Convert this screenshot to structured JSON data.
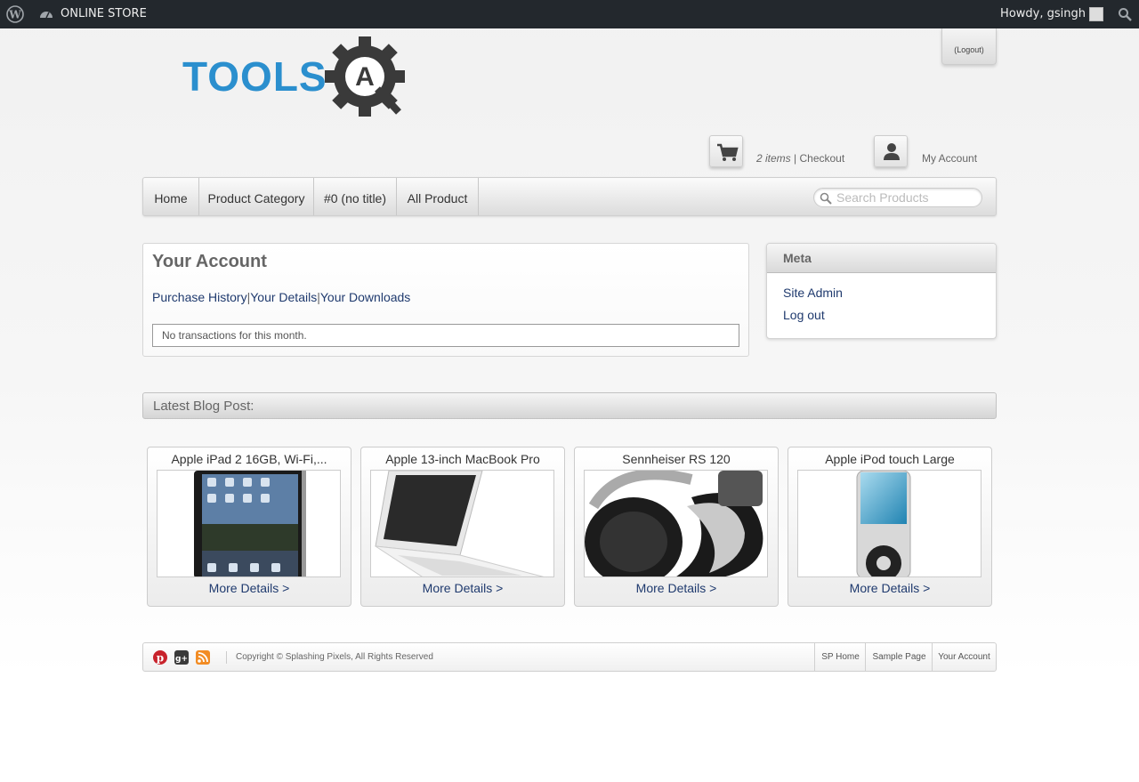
{
  "adminbar": {
    "site_name": "ONLINE STORE",
    "greeting": "Howdy, gsingh"
  },
  "header": {
    "logout_label": "(Logout)",
    "logo_text": "TOOLS",
    "logo_letter": "A",
    "cart_items": "2 items",
    "cart_separator": " | ",
    "checkout_label": "Checkout",
    "account_label": "My Account"
  },
  "nav": {
    "items": [
      {
        "label": "Home"
      },
      {
        "label": "Product Category"
      },
      {
        "label": "#0 (no title)"
      },
      {
        "label": "All Product"
      }
    ],
    "search_placeholder": "Search Products"
  },
  "account": {
    "title": "Your Account",
    "links": [
      "Purchase History",
      "Your Details",
      "Your Downloads"
    ],
    "separator": "|",
    "transactions_message": "No transactions for this month."
  },
  "meta": {
    "title": "Meta",
    "links": [
      "Site Admin",
      "Log out"
    ]
  },
  "blog": {
    "heading": "Latest Blog Post:"
  },
  "products": [
    {
      "title": "Apple iPad 2 16GB, Wi-Fi,...",
      "more": "More Details >",
      "icon": "ipad"
    },
    {
      "title": "Apple 13-inch MacBook Pro",
      "more": "More Details >",
      "icon": "macbook"
    },
    {
      "title": "Sennheiser RS 120",
      "more": "More Details >",
      "icon": "headphones"
    },
    {
      "title": "Apple iPod touch Large",
      "more": "More Details >",
      "icon": "ipod"
    }
  ],
  "footer": {
    "copyright": "Copyright © Splashing Pixels, All Rights Reserved",
    "links": [
      "SP Home",
      "Sample Page",
      "Your Account"
    ]
  },
  "colors": {
    "adminbar_bg": "#23282d",
    "link": "#1f3a6e",
    "logo_blue": "#2b8fce",
    "logo_gear": "#3a3a3a"
  }
}
